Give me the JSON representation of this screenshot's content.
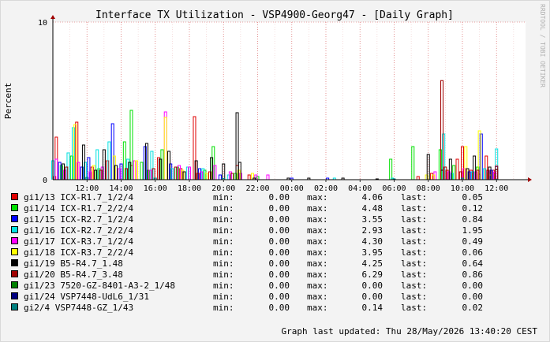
{
  "chart_data": {
    "type": "line",
    "title": "Interface TX Utilization - VSP4900-Georg47 - [Daily Graph]",
    "ylabel": "Percent",
    "xlabel": "",
    "ylim": [
      0,
      10
    ],
    "y_ticks": [
      "0",
      "10"
    ],
    "x_ticks": [
      "12:00",
      "14:00",
      "16:00",
      "18:00",
      "20:00",
      "22:00",
      "00:00",
      "02:00",
      "04:00",
      "06:00",
      "08:00",
      "10:00",
      "12:00"
    ],
    "grid": true,
    "watermark": "RRDTOOL / TOBI OETIKER",
    "legend_position": "bottom",
    "series": [
      {
        "name": "gi1/13 ICX-R1.7_1/2/4",
        "color": "#e00000",
        "min": "0.00",
        "max": "4.06",
        "last": "0.05",
        "spikes": [
          [
            10.2,
            2.7
          ],
          [
            11.4,
            3.65
          ],
          [
            12.3,
            0.8
          ],
          [
            13.2,
            1.2
          ],
          [
            14.6,
            0.9
          ],
          [
            16.2,
            1.4
          ],
          [
            17.5,
            0.7
          ],
          [
            18.3,
            4.0
          ],
          [
            19.2,
            0.5
          ],
          [
            20.8,
            0.9
          ],
          [
            10.1,
            0.2
          ],
          [
            21.5,
            0.3
          ],
          [
            31.4,
            0.2
          ],
          [
            32.2,
            0.4
          ],
          [
            33.1,
            0.6
          ],
          [
            33.7,
            1.3
          ],
          [
            34.0,
            2.1
          ],
          [
            34.5,
            0.6
          ],
          [
            35.0,
            0.35
          ],
          [
            35.4,
            1.5
          ],
          [
            35.8,
            0.6
          ]
        ]
      },
      {
        "name": "gi1/14 ICX-R1.7_2/2/4",
        "color": "#00e000",
        "min": "0.00",
        "max": "4.48",
        "last": "0.12",
        "spikes": [
          [
            10.5,
            0.9
          ],
          [
            11.1,
            1.5
          ],
          [
            12.7,
            0.7
          ],
          [
            14.2,
            2.4
          ],
          [
            14.6,
            4.4
          ],
          [
            15.2,
            1.1
          ],
          [
            15.6,
            0.6
          ],
          [
            16.4,
            1.9
          ],
          [
            17.3,
            0.8
          ],
          [
            18.9,
            0.6
          ],
          [
            19.4,
            2.1
          ],
          [
            20.7,
            0.4
          ],
          [
            22.0,
            0.2
          ],
          [
            29.8,
            1.3
          ],
          [
            31.1,
            2.1
          ],
          [
            32.7,
            1.9
          ],
          [
            33.5,
            0.9
          ],
          [
            34.9,
            0.8
          ],
          [
            35.9,
            0.3
          ]
        ]
      },
      {
        "name": "gi1/15 ICX-R2.7_1/2/4",
        "color": "#0000ff",
        "min": "0.00",
        "max": "3.55",
        "last": "0.84",
        "spikes": [
          [
            10.4,
            1.1
          ],
          [
            11.7,
            0.8
          ],
          [
            12.1,
            1.4
          ],
          [
            13.5,
            3.55
          ],
          [
            14.0,
            1.0
          ],
          [
            15.4,
            2.1
          ],
          [
            16.9,
            1.0
          ],
          [
            18.6,
            0.7
          ],
          [
            19.8,
            0.3
          ],
          [
            24.0,
            0.1
          ],
          [
            26.1,
            0.1
          ],
          [
            34.4,
            0.5
          ],
          [
            35.1,
            2.9
          ],
          [
            35.7,
            0.6
          ],
          [
            36.0,
            0.84
          ]
        ]
      },
      {
        "name": "gi1/16 ICX-R2.7_2/2/4",
        "color": "#00e0e0",
        "min": "0.00",
        "max": "2.93",
        "last": "1.95",
        "spikes": [
          [
            10.0,
            1.2
          ],
          [
            10.9,
            1.7
          ],
          [
            11.2,
            3.3
          ],
          [
            11.9,
            1.1
          ],
          [
            12.6,
            1.9
          ],
          [
            13.3,
            2.4
          ],
          [
            14.4,
            1.3
          ],
          [
            15.8,
            1.8
          ],
          [
            17.0,
            0.7
          ],
          [
            17.9,
            0.8
          ],
          [
            18.8,
            0.7
          ],
          [
            20.3,
            0.3
          ],
          [
            26.5,
            0.1
          ],
          [
            29.9,
            0.1
          ],
          [
            32.9,
            2.9
          ],
          [
            33.4,
            0.4
          ],
          [
            34.6,
            0.5
          ],
          [
            35.3,
            0.7
          ],
          [
            36.0,
            1.95
          ]
        ]
      },
      {
        "name": "gi1/17 ICX-R3.7_1/2/4",
        "color": "#ff00ff",
        "min": "0.00",
        "max": "4.30",
        "last": "0.49",
        "spikes": [
          [
            10.2,
            1.3
          ],
          [
            10.7,
            0.6
          ],
          [
            11.5,
            1.1
          ],
          [
            12.2,
            0.5
          ],
          [
            12.9,
            0.8
          ],
          [
            13.9,
            0.7
          ],
          [
            14.8,
            1.2
          ],
          [
            15.7,
            0.6
          ],
          [
            16.6,
            4.3
          ],
          [
            17.4,
            0.9
          ],
          [
            18.0,
            0.8
          ],
          [
            18.7,
            0.5
          ],
          [
            19.5,
            0.9
          ],
          [
            20.4,
            0.5
          ],
          [
            21.0,
            0.4
          ],
          [
            21.9,
            0.3
          ],
          [
            22.6,
            0.3
          ],
          [
            32.4,
            0.5
          ],
          [
            33.2,
            0.5
          ],
          [
            34.1,
            0.7
          ],
          [
            34.8,
            0.5
          ],
          [
            35.5,
            0.5
          ],
          [
            35.9,
            0.49
          ]
        ]
      },
      {
        "name": "gi1/18 ICX-R3.7_2/2/4",
        "color": "#ffff00",
        "min": "0.00",
        "max": "3.95",
        "last": "0.06",
        "spikes": [
          [
            11.3,
            3.5
          ],
          [
            12.4,
            0.9
          ],
          [
            13.6,
            1.5
          ],
          [
            14.9,
            1.2
          ],
          [
            16.6,
            3.95
          ],
          [
            17.6,
            0.6
          ],
          [
            19.0,
            0.4
          ],
          [
            20.9,
            0.6
          ],
          [
            21.7,
            0.4
          ],
          [
            31.9,
            0.3
          ],
          [
            32.3,
            0.3
          ],
          [
            34.2,
            2.1
          ],
          [
            35.0,
            3.1
          ],
          [
            35.6,
            0.3
          ]
        ]
      },
      {
        "name": "gi1/19 B5-R4.7_1.48",
        "color": "#000000",
        "min": "0.00",
        "max": "4.25",
        "last": "0.64",
        "spikes": [
          [
            10.6,
            1.0
          ],
          [
            11.8,
            2.2
          ],
          [
            12.5,
            0.6
          ],
          [
            13.0,
            1.9
          ],
          [
            13.7,
            0.9
          ],
          [
            14.5,
            1.1
          ],
          [
            15.5,
            2.3
          ],
          [
            16.3,
            1.3
          ],
          [
            16.8,
            1.8
          ],
          [
            17.7,
            0.5
          ],
          [
            18.4,
            1.2
          ],
          [
            19.3,
            1.4
          ],
          [
            20.0,
            1.0
          ],
          [
            20.8,
            4.25
          ],
          [
            20.95,
            1.1
          ],
          [
            21.8,
            0.1
          ],
          [
            23.8,
            0.1
          ],
          [
            25.0,
            0.1
          ],
          [
            27.0,
            0.1
          ],
          [
            29.0,
            0.05
          ],
          [
            32.0,
            1.6
          ],
          [
            32.8,
            0.6
          ],
          [
            33.3,
            1.3
          ],
          [
            34.3,
            0.7
          ],
          [
            34.7,
            1.5
          ],
          [
            35.6,
            0.8
          ],
          [
            36.0,
            0.64
          ]
        ]
      },
      {
        "name": "gi1/20 B5-R4.7_3.48",
        "color": "#a00000",
        "min": "0.00",
        "max": "6.29",
        "last": "0.86",
        "spikes": [
          [
            10.8,
            0.8
          ],
          [
            12.8,
            0.6
          ],
          [
            14.3,
            0.7
          ],
          [
            15.9,
            0.7
          ],
          [
            17.2,
            0.8
          ],
          [
            18.5,
            0.4
          ],
          [
            20.5,
            0.4
          ],
          [
            32.8,
            6.29
          ],
          [
            33.0,
            0.8
          ],
          [
            33.9,
            0.5
          ],
          [
            34.9,
            0.6
          ],
          [
            35.5,
            0.6
          ],
          [
            36.0,
            0.86
          ]
        ]
      },
      {
        "name": "gi1/23 7520-GZ-8401-A3-2_1/48",
        "color": "#008000",
        "min": "0.00",
        "max": "0.00",
        "last": "0.00",
        "spikes": []
      },
      {
        "name": "gi1/24 VSP7448-UdL6_1/31",
        "color": "#000080",
        "min": "0.00",
        "max": "0.00",
        "last": "0.00",
        "spikes": []
      },
      {
        "name": "gi2/4 VSP7448-GZ_1/43",
        "color": "#008080",
        "min": "0.00",
        "max": "0.14",
        "last": "0.02",
        "spikes": [
          [
            12.0,
            0.14
          ],
          [
            16.0,
            0.1
          ],
          [
            20.0,
            0.08
          ],
          [
            30.0,
            0.05
          ],
          [
            34.0,
            0.1
          ],
          [
            36.0,
            0.02
          ]
        ]
      }
    ]
  },
  "legend_labels": {
    "min": "min:",
    "max": "max:",
    "last": "last:"
  },
  "footer": "Graph last updated: Thu 28/May/2026 13:40:20 CEST"
}
